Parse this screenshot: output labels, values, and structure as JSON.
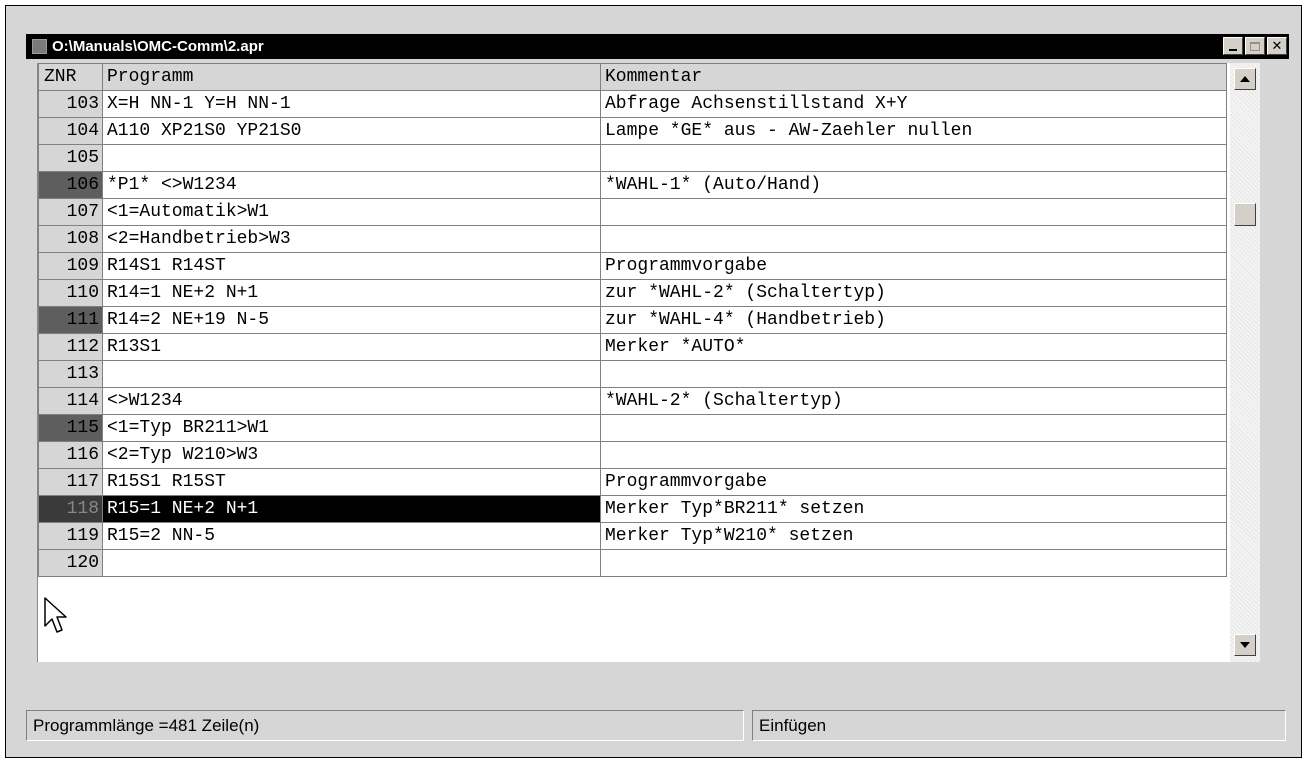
{
  "window": {
    "title": "O:\\Manuals\\OMC-Comm\\2.apr"
  },
  "table": {
    "columns": [
      "ZNR",
      "Programm",
      "Kommentar"
    ],
    "rows": [
      {
        "znr": "103",
        "programm": "X=H NN-1 Y=H NN-1",
        "kommentar": "Abfrage Achsenstillstand X+Y",
        "marked": false,
        "selected": false
      },
      {
        "znr": "104",
        "programm": "A110 XP21S0 YP21S0",
        "kommentar": "Lampe *GE* aus - AW-Zaehler nullen",
        "marked": false,
        "selected": false
      },
      {
        "znr": "105",
        "programm": "",
        "kommentar": "",
        "marked": false,
        "selected": false
      },
      {
        "znr": "106",
        "programm": "*P1* <>W1234",
        "kommentar": "*WAHL-1* (Auto/Hand)",
        "marked": true,
        "selected": false
      },
      {
        "znr": "107",
        "programm": "<1=Automatik>W1",
        "kommentar": "",
        "marked": false,
        "selected": false
      },
      {
        "znr": "108",
        "programm": "<2=Handbetrieb>W3",
        "kommentar": "",
        "marked": false,
        "selected": false
      },
      {
        "znr": "109",
        "programm": "R14S1 R14ST",
        "kommentar": "Programmvorgabe",
        "marked": false,
        "selected": false
      },
      {
        "znr": "110",
        "programm": "R14=1 NE+2 N+1",
        "kommentar": "zur *WAHL-2* (Schaltertyp)",
        "marked": false,
        "selected": false
      },
      {
        "znr": "111",
        "programm": "R14=2 NE+19 N-5",
        "kommentar": "zur *WAHL-4* (Handbetrieb)",
        "marked": true,
        "selected": false
      },
      {
        "znr": "112",
        "programm": "R13S1",
        "kommentar": "Merker *AUTO*",
        "marked": false,
        "selected": false
      },
      {
        "znr": "113",
        "programm": "",
        "kommentar": "",
        "marked": false,
        "selected": false
      },
      {
        "znr": "114",
        "programm": "<>W1234",
        "kommentar": "*WAHL-2* (Schaltertyp)",
        "marked": false,
        "selected": false
      },
      {
        "znr": "115",
        "programm": "<1=Typ BR211>W1",
        "kommentar": "",
        "marked": true,
        "selected": false
      },
      {
        "znr": "116",
        "programm": "<2=Typ W210>W3",
        "kommentar": "",
        "marked": false,
        "selected": false
      },
      {
        "znr": "117",
        "programm": "R15S1 R15ST",
        "kommentar": "Programmvorgabe",
        "marked": false,
        "selected": false
      },
      {
        "znr": "118",
        "programm": "R15=1 NE+2 N+1",
        "kommentar": "Merker Typ*BR211* setzen",
        "marked": true,
        "selected": true
      },
      {
        "znr": "119",
        "programm": "R15=2 NN-5",
        "kommentar": "Merker Typ*W210* setzen",
        "marked": false,
        "selected": false
      },
      {
        "znr": "120",
        "programm": "",
        "kommentar": "",
        "marked": false,
        "selected": false
      }
    ]
  },
  "status": {
    "left": "Programmlänge =481 Zeile(n)",
    "right": "Einfügen"
  },
  "icons": {
    "window_controls": [
      "minimize-icon",
      "maximize-icon",
      "close-icon"
    ],
    "scroll": [
      "scroll-up-arrow-icon",
      "scroll-down-arrow-icon"
    ],
    "pointer": "mouse-cursor-icon"
  }
}
